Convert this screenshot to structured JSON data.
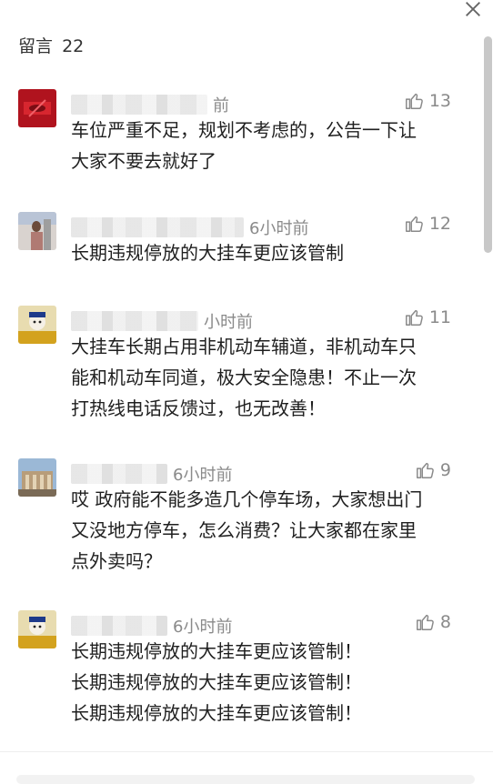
{
  "header": {
    "title": "留言",
    "count": "22"
  },
  "comments": [
    {
      "time": "前",
      "likes": "13",
      "lines": [
        "车位严重不足，规划不考虑的，公告一下让",
        "大家不要去就好了"
      ]
    },
    {
      "time": "6小时前",
      "likes": "12",
      "lines": [
        "长期违规停放的大挂车更应该管制"
      ]
    },
    {
      "time": "小时前",
      "likes": "11",
      "lines": [
        "大挂车长期占用非机动车辅道，非机动车只",
        "能和机动车同道，极大安全隐患！不止一次",
        "打热线电话反馈过，也无改善！"
      ]
    },
    {
      "time": "6小时前",
      "likes": "9",
      "lines": [
        "哎  政府能不能多造几个停车场，大家想出门",
        "又没地方停车，怎么消费？让大家都在家里",
        "点外卖吗？"
      ]
    },
    {
      "time": "6小时前",
      "likes": "8",
      "lines": [
        "长期违规停放的大挂车更应该管制！",
        "长期违规停放的大挂车更应该管制！",
        "长期违规停放的大挂车更应该管制！"
      ]
    }
  ]
}
